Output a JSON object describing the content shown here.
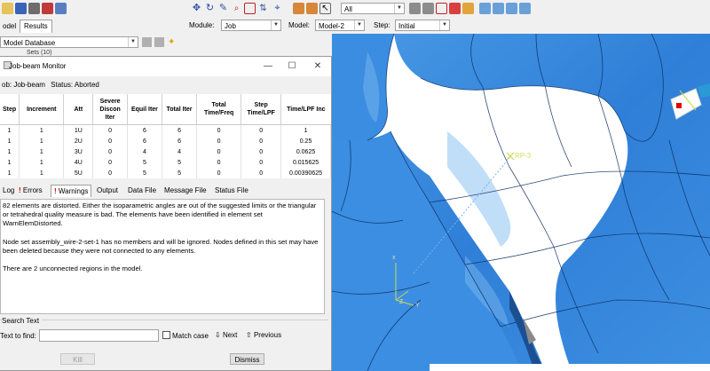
{
  "toolbar": {
    "icons": [
      "folder-icon",
      "save-icon",
      "print-icon",
      "home-icon",
      "move-icon",
      "rotate-icon",
      "pan-icon",
      "zoom-icon",
      "box-zoom-icon",
      "fit-icon",
      "cursor-icon",
      "filter-icon",
      "view-icon",
      "render-icon",
      "shade-icon",
      "wireframe-icon",
      "hidden-icon"
    ],
    "selection_filter": "All"
  },
  "left_tabs": {
    "model": "odel",
    "results": "Results"
  },
  "model_db": {
    "value": "Model Database",
    "tree_item": "Sets (10)"
  },
  "context": {
    "module_label": "Module:",
    "module_value": "Job",
    "model_label": "Model:",
    "model_value": "Model-2",
    "step_label": "Step:",
    "step_value": "Initial"
  },
  "monitor": {
    "title": "Job-beam Monitor",
    "job_label": "ob:",
    "job_name": "Job-beam",
    "status_label": "Status:",
    "status_value": "Aborted",
    "columns": [
      "Step",
      "Increment",
      "Att",
      "Severe Discon Iter",
      "Equil Iter",
      "Total Iter",
      "Total Time/Freq",
      "Step Time/LPF",
      "Time/LPF Inc"
    ],
    "rows": [
      [
        "1",
        "1",
        "1U",
        "0",
        "6",
        "6",
        "0",
        "0",
        "1"
      ],
      [
        "1",
        "1",
        "2U",
        "0",
        "6",
        "6",
        "0",
        "0",
        "0.25"
      ],
      [
        "1",
        "1",
        "3U",
        "0",
        "4",
        "4",
        "0",
        "0",
        "0.0625"
      ],
      [
        "1",
        "1",
        "4U",
        "0",
        "5",
        "5",
        "0",
        "0",
        "0.015625"
      ],
      [
        "1",
        "1",
        "5U",
        "0",
        "5",
        "5",
        "0",
        "0",
        "0.00390625"
      ]
    ],
    "tabs": {
      "log": "Log",
      "errors": "Errors",
      "warnings": "Warnings",
      "output": "Output",
      "data_file": "Data File",
      "message_file": "Message File",
      "status_file": "Status File"
    },
    "messages": [
      "82 elements are distorted. Either the isoparametric angles are out of the suggested limits or the triangular or tetrahedral quality measure is bad. The elements have been identified in element set WarnElemDistorted.",
      "Node set assembly_wire-2-set-1 has no members and will be ignored. Nodes defined in this set may have been deleted because they were not connected to any elements.",
      "There are 2 unconnected regions in the model."
    ],
    "search": {
      "section_label": "Search Text",
      "find_label": "Text to find:",
      "find_value": "",
      "match_case": "Match case",
      "next": "Next",
      "previous": "Previous"
    },
    "kill_button": "Kill",
    "dismiss_button": "Dismiss"
  },
  "viewport": {
    "rp_label": "RP-3",
    "axis_x": "x",
    "axis_y": "Y",
    "axis_z": "Z"
  },
  "colors": {
    "mesh": "#3a8de0",
    "mesh_dark": "#1e5fb0",
    "mesh_light": "#7fbaf0",
    "rp": "#c8d84a"
  }
}
